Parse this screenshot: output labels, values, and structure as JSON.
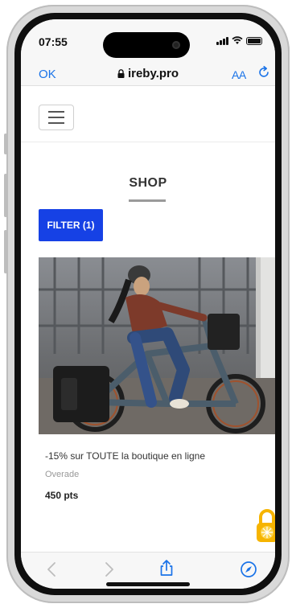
{
  "status_bar": {
    "time": "07:55"
  },
  "browser": {
    "done_label": "OK",
    "url": "ireby.pro",
    "text_size_label": "AA"
  },
  "page": {
    "title": "SHOP",
    "filter_label": "FILTER (1)"
  },
  "product": {
    "title": "-15% sur TOUTE la boutique en ligne",
    "brand": "Overade",
    "points": "450 pts"
  },
  "icons": {
    "menu": "hamburger-icon",
    "lock": "lock-icon",
    "reload": "reload-icon",
    "back": "chevron-left-icon",
    "forward": "chevron-right-icon",
    "share": "share-icon",
    "compass": "compass-icon",
    "rewards": "padlock-icon"
  },
  "colors": {
    "accent": "#1641e5",
    "link": "#1a73e8",
    "rewards_lock": "#f6b400"
  }
}
